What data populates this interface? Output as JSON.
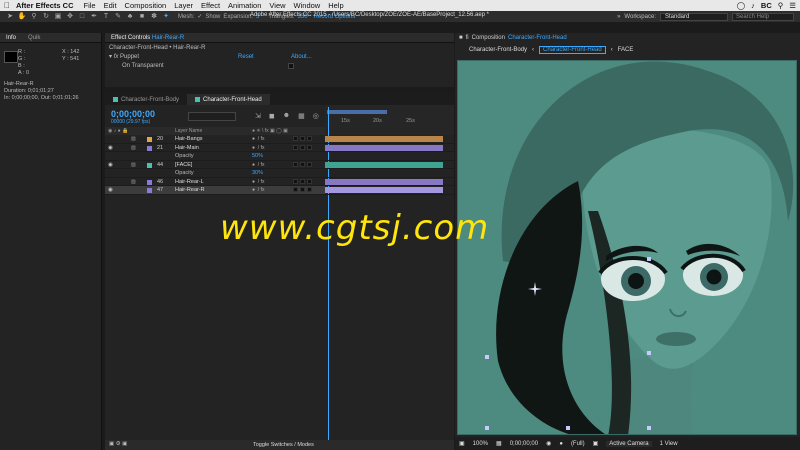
{
  "menubar": {
    "app": "After Effects CC",
    "items": [
      "File",
      "Edit",
      "Composition",
      "Layer",
      "Effect",
      "Animation",
      "View",
      "Window",
      "Help"
    ],
    "user": "BC"
  },
  "titlebar": {
    "text": "Adobe After Effects CC 2015 - /Users/BC/Desktop/ZOE/ZOE-AE/BaseProject_12.56.aep *"
  },
  "toolbar": {
    "mesh_label": "Mesh:",
    "show_label": "Show",
    "expansion_label": "Expansion:",
    "expansion_value": "3",
    "triangles_label": "Triangles:",
    "triangles_value": "350",
    "record_options": "Record Options",
    "workspace_label": "Workspace:",
    "workspace_value": "Standard",
    "search_placeholder": "Search Help"
  },
  "info_panel": {
    "tabs": [
      "Info",
      "Quik"
    ],
    "r": "R :",
    "g": "G :",
    "b": "B :",
    "a": "A : 0",
    "x": "X : 142",
    "y": "Y : 541",
    "layer_name": "Hair-Rear-R",
    "duration": "Duration: 0;01;01;27",
    "in_out": "In: 0;00;00;00, Out: 0;01;01;26"
  },
  "effect_controls": {
    "tab_label": "Effect Controls",
    "tab_layer": "Hair-Rear-R",
    "breadcrumb": "Character-Front-Head • Hair-Rear-R",
    "effect_name": "Puppet",
    "reset": "Reset",
    "about": "About...",
    "on_transparent": "On Transparent"
  },
  "timeline": {
    "tabs": [
      "Character-Front-Body",
      "Character-Front-Head"
    ],
    "timecode": "0;00;00;00",
    "timecode_sub": "00000 (29.97 fps)",
    "column_layer_name": "Layer Name",
    "ruler_ticks": [
      "15s",
      "20s",
      "25s"
    ],
    "layers": [
      {
        "num": "20",
        "name": "Hair-Bangs",
        "label_color": "#e0a64b",
        "bar_color": "#b8864a",
        "visible": false,
        "locked": true
      },
      {
        "num": "21",
        "name": "Hair-Main",
        "label_color": "#8c7bd6",
        "bar_color": "#8877c4",
        "visible": true,
        "locked": true,
        "prop": {
          "name": "Opacity",
          "value": "50%"
        }
      },
      {
        "num": "44",
        "name": "[FACE]",
        "label_color": "#4bc0b0",
        "bar_color": "#3fa392",
        "visible": true,
        "locked": true,
        "prop": {
          "name": "Opacity",
          "value": "30%"
        }
      },
      {
        "num": "46",
        "name": "Hair-Rear-L",
        "label_color": "#8c7bd6",
        "bar_color": "#8877c4",
        "visible": false,
        "locked": true
      },
      {
        "num": "47",
        "name": "Hair-Rear-R",
        "label_color": "#8c7bd6",
        "bar_color": "#a596e0",
        "visible": true,
        "locked": false,
        "selected": true
      }
    ],
    "toggle_label": "Toggle Switches / Modes"
  },
  "composition": {
    "tab_label": "Composition",
    "tab_comp": "Character-Front-Head",
    "breadcrumbs": [
      "Character-Front-Body",
      "Character-Front-Head",
      "FACE"
    ],
    "zoom": "100%",
    "timecode": "0;00;00;00",
    "resolution": "(Full)",
    "camera": "Active Camera",
    "views": "1 View"
  },
  "watermark": "www.cgtsj.com",
  "colors": {
    "accent": "#3ca9ff",
    "canvas": "#4d8a80",
    "watermark": "#ffe50a"
  }
}
